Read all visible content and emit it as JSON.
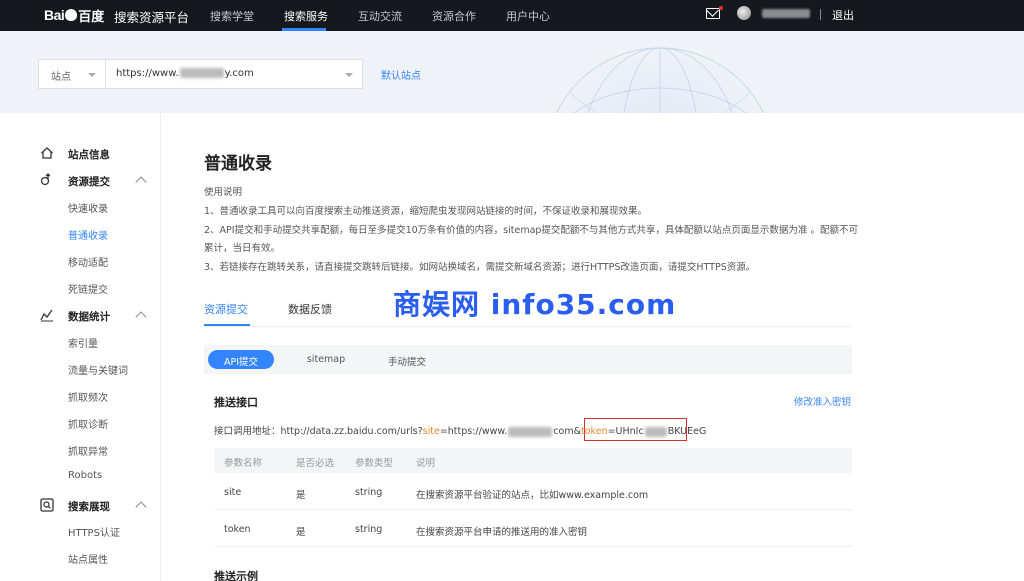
{
  "topnav": {
    "logo_bai": "Bai",
    "logo_du": "百度",
    "platform": "搜索资源平台",
    "links": [
      "搜索学堂",
      "搜索服务",
      "互动交流",
      "资源合作",
      "用户中心"
    ],
    "active_link": "搜索服务",
    "logout": "退出",
    "accent": "#3385ff"
  },
  "banner": {
    "site_select": "站点",
    "url_prefix": "https://www.",
    "url_suffix": "y.com",
    "default_site": "默认站点"
  },
  "sidebar": {
    "groups": [
      {
        "label": "站点信息",
        "icon": "home-icon",
        "items": []
      },
      {
        "label": "资源提交",
        "icon": "resource-submit-icon",
        "items": [
          "快速收录",
          "普通收录",
          "移动适配",
          "死链提交"
        ]
      },
      {
        "label": "数据统计",
        "icon": "stats-chart-icon",
        "items": [
          "索引量",
          "流量与关键词",
          "抓取频次",
          "抓取诊断",
          "抓取异常",
          "Robots"
        ]
      },
      {
        "label": "搜索展现",
        "icon": "search-display-icon",
        "items": [
          "HTTPS认证",
          "站点属性"
        ]
      }
    ],
    "active_item": "普通收录"
  },
  "main": {
    "title": "普通收录",
    "usage_title": "使用说明",
    "usage_lines": [
      "1、普通收录工具可以向百度搜索主动推送资源，缩短爬虫发现网站链接的时间，不保证收录和展现效果。",
      "2、API提交和手动提交共享配额，每日至多提交10万条有价值的内容，sitemap提交配额不与其他方式共享，具体配额以站点页面显示数据为准 。配额不可",
      "累计，当日有效。",
      "3、若链接存在跳转关系，请直接提交跳转后链接。如网站换域名，需提交新域名资源；进行HTTPS改造页面，请提交HTTPS资源。"
    ],
    "tabs": [
      "资源提交",
      "数据反馈"
    ],
    "watermark": "商娱网 info35.com",
    "subtabs": [
      "API提交",
      "sitemap",
      "手动提交"
    ],
    "push_title": "推送接口",
    "edit_token": "修改准入密钥",
    "api_label": "接口调用地址：",
    "api_url_1": "http://data.zz.baidu.com/urls?",
    "api_site_key": "site",
    "api_url_2": "=https://www.",
    "api_url_3": "com&",
    "api_token_key": "token",
    "api_token_prefix": "=UHnIc",
    "api_token_suffix": "BKUEeG",
    "table": {
      "headers": [
        "参数名称",
        "是否必选",
        "参数类型",
        "说明"
      ],
      "rows": [
        [
          "site",
          "是",
          "string",
          "在搜索资源平台验证的站点，比如www.example.com"
        ],
        [
          "token",
          "是",
          "string",
          "在搜索资源平台申请的推送用的准入密钥"
        ]
      ]
    },
    "example_title": "推送示例"
  }
}
